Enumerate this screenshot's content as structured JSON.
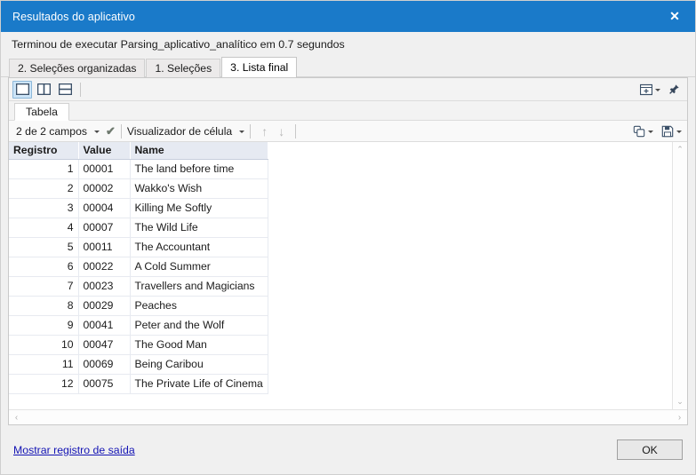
{
  "window": {
    "title": "Resultados do aplicativo",
    "close_label": "✕",
    "titlebar_color": "#1a7ac9"
  },
  "message": {
    "text": "Terminou de executar Parsing_aplicativo_analítico em 0.7 segundos"
  },
  "tabs": [
    {
      "label": "2. Seleções organizadas",
      "active": false
    },
    {
      "label": "1. Seleções",
      "active": false
    },
    {
      "label": "3. Lista final",
      "active": true
    }
  ],
  "viewbar": {
    "layout_buttons": [
      {
        "name": "layout-single-pane",
        "active": true
      },
      {
        "name": "layout-vertical-split",
        "active": false
      },
      {
        "name": "layout-horizontal-split",
        "active": false
      }
    ],
    "add_panel_icon": "add-panel-icon",
    "pin_icon": "pushpin-icon"
  },
  "subtabs": [
    {
      "label": "Tabela",
      "active": true
    }
  ],
  "fieldbar": {
    "fields_label": "2 de 2 campos",
    "check_glyph": "✔",
    "viewer_label": "Visualizador de célula",
    "up_glyph": "↑",
    "down_glyph": "↓",
    "copy_icon": "copy-icon",
    "save_icon": "save-floppy-icon"
  },
  "grid": {
    "columns": [
      "Registro",
      "Value",
      "Name"
    ],
    "rows": [
      {
        "registro": "1",
        "value": "00001",
        "name": "The land before time"
      },
      {
        "registro": "2",
        "value": "00002",
        "name": "Wakko's Wish"
      },
      {
        "registro": "3",
        "value": "00004",
        "name": "Killing Me Softly"
      },
      {
        "registro": "4",
        "value": "00007",
        "name": "The Wild Life"
      },
      {
        "registro": "5",
        "value": "00011",
        "name": "The Accountant"
      },
      {
        "registro": "6",
        "value": "00022",
        "name": "A Cold Summer"
      },
      {
        "registro": "7",
        "value": "00023",
        "name": "Travellers and Magicians"
      },
      {
        "registro": "8",
        "value": "00029",
        "name": "Peaches"
      },
      {
        "registro": "9",
        "value": "00041",
        "name": "Peter and the Wolf"
      },
      {
        "registro": "10",
        "value": "00047",
        "name": "The Good Man"
      },
      {
        "registro": "11",
        "value": "00069",
        "name": "Being Caribou"
      },
      {
        "registro": "12",
        "value": "00075",
        "name": "The Private Life of Cinema"
      }
    ]
  },
  "scrollbars": {
    "up_glyph": "⌃",
    "down_glyph": "⌄",
    "left_glyph": "‹",
    "right_glyph": "›"
  },
  "footer": {
    "link_label": "Mostrar registro de saída",
    "ok_label": "OK"
  }
}
